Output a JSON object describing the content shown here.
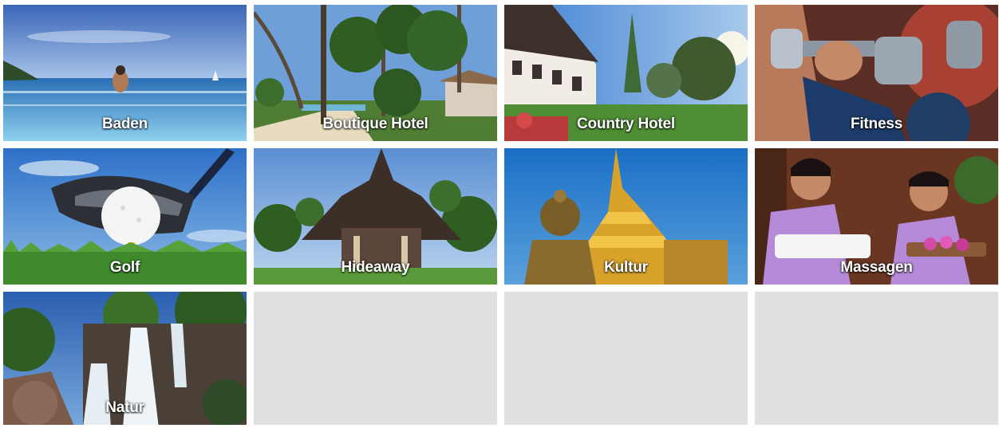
{
  "tiles": [
    {
      "label": "Baden",
      "icon": "infinity-pool-photo"
    },
    {
      "label": "Boutique Hotel",
      "icon": "palm-beach-photo"
    },
    {
      "label": "Country Hotel",
      "icon": "country-hotel-photo"
    },
    {
      "label": "Fitness",
      "icon": "dumbbell-photo"
    },
    {
      "label": "Golf",
      "icon": "golf-ball-photo"
    },
    {
      "label": "Hideaway",
      "icon": "thai-pavilion-photo"
    },
    {
      "label": "Kultur",
      "icon": "golden-pagoda-photo"
    },
    {
      "label": "Massagen",
      "icon": "spa-therapists-photo"
    },
    {
      "label": "Natur",
      "icon": "waterfall-photo"
    }
  ]
}
